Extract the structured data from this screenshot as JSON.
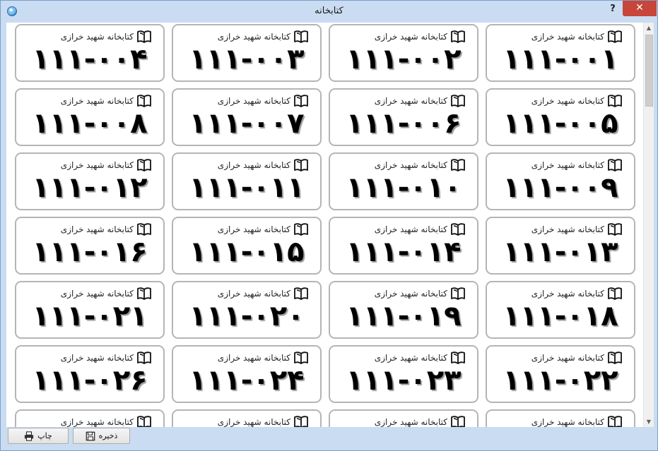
{
  "window": {
    "title": "کتابخانه",
    "help_label": "?",
    "close_label": "✕"
  },
  "cards": [
    {
      "library": "کتابخانه شهید خرازی",
      "code": "۱۱۱-۰۰۴"
    },
    {
      "library": "کتابخانه شهید خرازی",
      "code": "۱۱۱-۰۰۳"
    },
    {
      "library": "کتابخانه شهید خرازی",
      "code": "۱۱۱-۰۰۲"
    },
    {
      "library": "کتابخانه شهید خرازی",
      "code": "۱۱۱-۰۰۱"
    },
    {
      "library": "کتابخانه شهید خرازی",
      "code": "۱۱۱-۰۰۸"
    },
    {
      "library": "کتابخانه شهید خرازی",
      "code": "۱۱۱-۰۰۷"
    },
    {
      "library": "کتابخانه شهید خرازی",
      "code": "۱۱۱-۰۰۶"
    },
    {
      "library": "کتابخانه شهید خرازی",
      "code": "۱۱۱-۰۰۵"
    },
    {
      "library": "کتابخانه شهید خرازی",
      "code": "۱۱۱-۰۱۲"
    },
    {
      "library": "کتابخانه شهید خرازی",
      "code": "۱۱۱-۰۱۱"
    },
    {
      "library": "کتابخانه شهید خرازی",
      "code": "۱۱۱-۰۱۰"
    },
    {
      "library": "کتابخانه شهید خرازی",
      "code": "۱۱۱-۰۰۹"
    },
    {
      "library": "کتابخانه شهید خرازی",
      "code": "۱۱۱-۰۱۶"
    },
    {
      "library": "کتابخانه شهید خرازی",
      "code": "۱۱۱-۰۱۵"
    },
    {
      "library": "کتابخانه شهید خرازی",
      "code": "۱۱۱-۰۱۴"
    },
    {
      "library": "کتابخانه شهید خرازی",
      "code": "۱۱۱-۰۱۳"
    },
    {
      "library": "کتابخانه شهید خرازی",
      "code": "۱۱۱-۰۲۱"
    },
    {
      "library": "کتابخانه شهید خرازی",
      "code": "۱۱۱-۰۲۰"
    },
    {
      "library": "کتابخانه شهید خرازی",
      "code": "۱۱۱-۰۱۹"
    },
    {
      "library": "کتابخانه شهید خرازی",
      "code": "۱۱۱-۰۱۸"
    },
    {
      "library": "کتابخانه شهید خرازی",
      "code": "۱۱۱-۰۲۶"
    },
    {
      "library": "کتابخانه شهید خرازی",
      "code": "۱۱۱-۰۲۴"
    },
    {
      "library": "کتابخانه شهید خرازی",
      "code": "۱۱۱-۰۲۳"
    },
    {
      "library": "کتابخانه شهید خرازی",
      "code": "۱۱۱-۰۲۲"
    },
    {
      "library": "کتابخانه شهید خرازی",
      "code": ""
    },
    {
      "library": "کتابخانه شهید خرازی",
      "code": ""
    },
    {
      "library": "کتابخانه شهید خرازی",
      "code": ""
    },
    {
      "library": "کتابخانه شهید خرازی",
      "code": ""
    }
  ],
  "footer": {
    "print_label": "چاپ",
    "save_label": "ذخیره"
  },
  "icons": {
    "card": "book-icon",
    "print": "printer-icon",
    "save": "floppy-disk-icon",
    "app": "app-icon"
  }
}
